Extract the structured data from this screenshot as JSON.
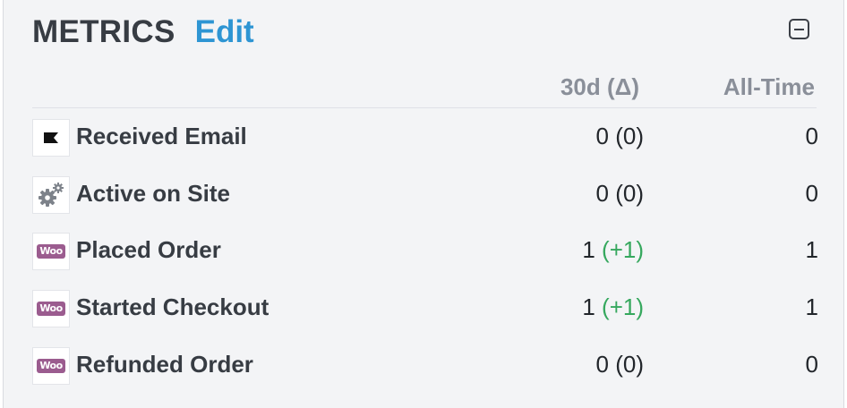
{
  "header": {
    "title": "METRICS",
    "edit_label": "Edit"
  },
  "columns": {
    "period": "30d (Δ)",
    "all_time": "All-Time"
  },
  "metrics": [
    {
      "icon": "flag-icon",
      "label": "Received Email",
      "value_30d": "0",
      "delta_30d": "(0)",
      "delta_positive": false,
      "all_time": "0"
    },
    {
      "icon": "gears-icon",
      "label": "Active on Site",
      "value_30d": "0",
      "delta_30d": "(0)",
      "delta_positive": false,
      "all_time": "0"
    },
    {
      "icon": "woo-icon",
      "label": "Placed Order",
      "value_30d": "1",
      "delta_30d": "(+1)",
      "delta_positive": true,
      "all_time": "1"
    },
    {
      "icon": "woo-icon",
      "label": "Started Checkout",
      "value_30d": "1",
      "delta_30d": "(+1)",
      "delta_positive": true,
      "all_time": "1"
    },
    {
      "icon": "woo-icon",
      "label": "Refunded Order",
      "value_30d": "0",
      "delta_30d": "(0)",
      "delta_positive": false,
      "all_time": "0"
    }
  ],
  "woo_text": "Woo",
  "colors": {
    "accent": "#2e95d3",
    "positive": "#36a85e",
    "woo_purple": "#9b5c8f"
  }
}
